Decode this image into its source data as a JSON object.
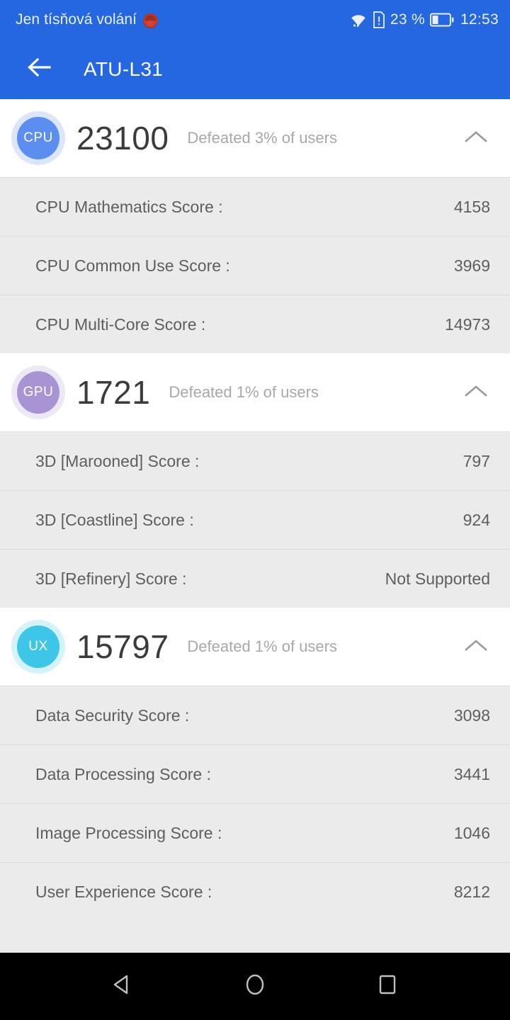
{
  "statusbar": {
    "carrier": "Jen tísňová volání",
    "battery_percent": "23 %",
    "clock": "12:53",
    "icons": [
      "notification-emoji-icon",
      "wifi-icon",
      "sim-card-alert-icon",
      "battery-icon"
    ]
  },
  "appbar": {
    "title": "ATU-L31",
    "back_icon": "arrow-back-icon",
    "accent_color": "#2467e0"
  },
  "sections": [
    {
      "key": "cpu",
      "badge_label": "CPU",
      "badge_color": "#5b8ef0",
      "score": "23100",
      "defeated": "Defeated 3% of users",
      "toggle_icon": "chevron-up-icon",
      "rows": [
        {
          "label": "CPU Mathematics Score :",
          "value": "4158"
        },
        {
          "label": "CPU Common Use Score :",
          "value": "3969"
        },
        {
          "label": "CPU Multi-Core Score :",
          "value": "14973"
        }
      ]
    },
    {
      "key": "gpu",
      "badge_label": "GPU",
      "badge_color": "#a894d4",
      "score": "1721",
      "defeated": "Defeated 1% of users",
      "toggle_icon": "chevron-up-icon",
      "rows": [
        {
          "label": "3D [Marooned] Score :",
          "value": "797"
        },
        {
          "label": "3D [Coastline] Score :",
          "value": "924"
        },
        {
          "label": "3D [Refinery] Score :",
          "value": "Not Supported"
        }
      ]
    },
    {
      "key": "ux",
      "badge_label": "UX",
      "badge_color": "#3dc6e8",
      "score": "15797",
      "defeated": "Defeated 1% of users",
      "toggle_icon": "chevron-up-icon",
      "rows": [
        {
          "label": "Data Security Score :",
          "value": "3098"
        },
        {
          "label": "Data Processing Score :",
          "value": "3441"
        },
        {
          "label": "Image Processing Score :",
          "value": "1046"
        },
        {
          "label": "User Experience Score :",
          "value": "8212"
        }
      ]
    }
  ],
  "navbar": {
    "back_icon": "nav-back-triangle-icon",
    "home_icon": "nav-home-circle-icon",
    "recents_icon": "nav-recents-square-icon"
  }
}
